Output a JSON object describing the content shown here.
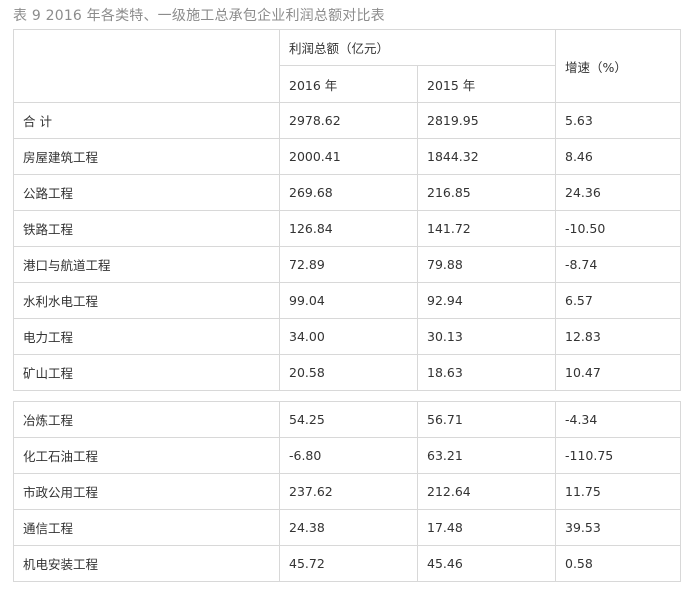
{
  "title": "表 9 2016 年各类特、一级施工总承包企业利润总额对比表",
  "header": {
    "profit_label": "利润总额（亿元）",
    "year_2016": "2016 年",
    "year_2015": "2015 年",
    "growth_label": "增速（%）"
  },
  "rows_top": [
    {
      "name": "合 计",
      "y2016": "2978.62",
      "y2015": "2819.95",
      "growth": "5.63"
    },
    {
      "name": "房屋建筑工程",
      "y2016": "2000.41",
      "y2015": "1844.32",
      "growth": "8.46"
    },
    {
      "name": "公路工程",
      "y2016": "269.68",
      "y2015": "216.85",
      "growth": "24.36"
    },
    {
      "name": "铁路工程",
      "y2016": "126.84",
      "y2015": "141.72",
      "growth": "-10.50"
    },
    {
      "name": "港口与航道工程",
      "y2016": "72.89",
      "y2015": "79.88",
      "growth": "-8.74"
    },
    {
      "name": "水利水电工程",
      "y2016": "99.04",
      "y2015": "92.94",
      "growth": "6.57"
    },
    {
      "name": "电力工程",
      "y2016": "34.00",
      "y2015": "30.13",
      "growth": "12.83"
    },
    {
      "name": "矿山工程",
      "y2016": "20.58",
      "y2015": "18.63",
      "growth": "10.47"
    }
  ],
  "rows_bottom": [
    {
      "name": "冶炼工程",
      "y2016": "54.25",
      "y2015": "56.71",
      "growth": "-4.34"
    },
    {
      "name": "化工石油工程",
      "y2016": "-6.80",
      "y2015": "63.21",
      "growth": "-110.75"
    },
    {
      "name": "市政公用工程",
      "y2016": "237.62",
      "y2015": "212.64",
      "growth": "11.75"
    },
    {
      "name": "通信工程",
      "y2016": "24.38",
      "y2015": "17.48",
      "growth": "39.53"
    },
    {
      "name": "机电安装工程",
      "y2016": "45.72",
      "y2015": "45.46",
      "growth": "0.58"
    }
  ]
}
